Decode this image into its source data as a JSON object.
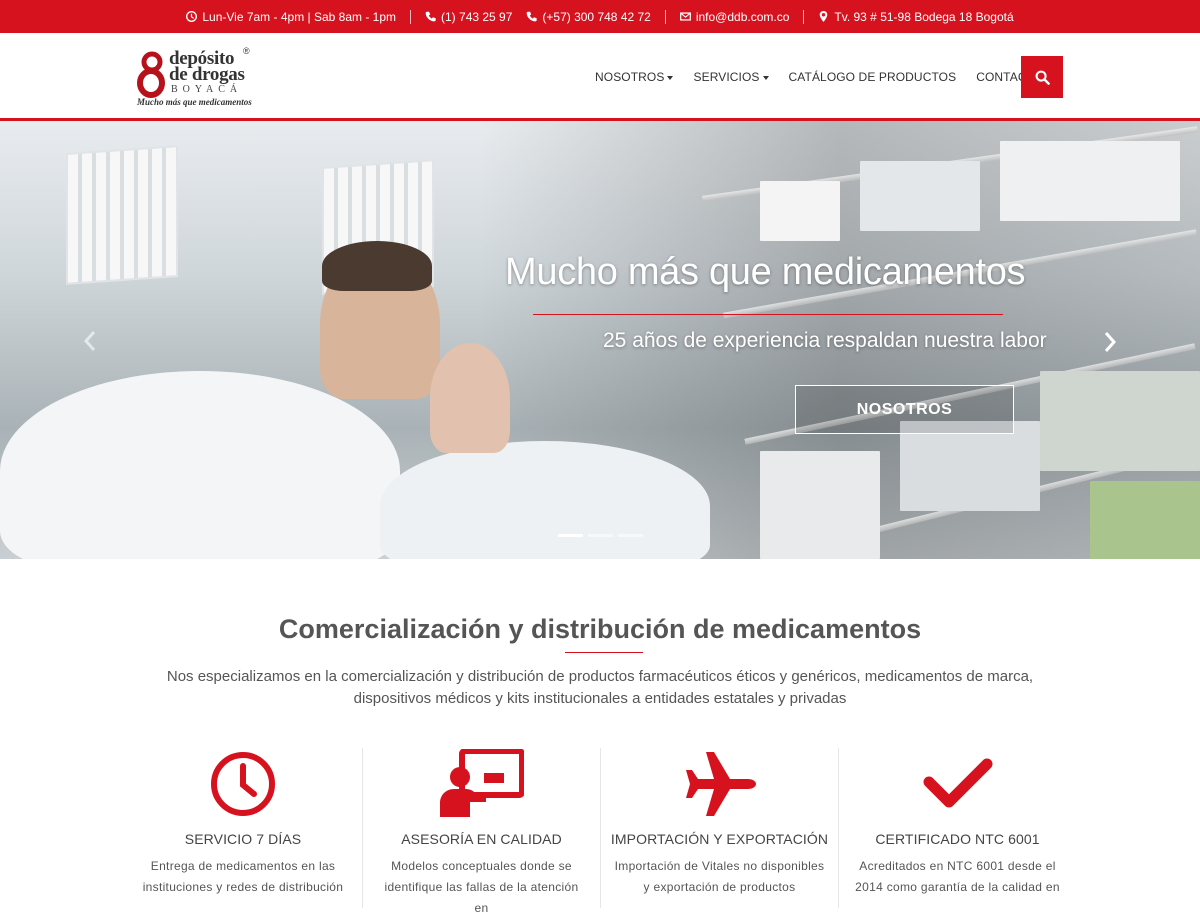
{
  "colors": {
    "brand": "#d7121f",
    "text": "#444444",
    "white": "#ffffff"
  },
  "topbar": {
    "hours": "Lun-Vie 7am - 4pm | Sab 8am - 1pm",
    "phone1": "(1) 743 25 97",
    "phone2": "(+57) 300 748 42 72",
    "email": "info@ddb.com.co",
    "address": "Tv. 93 # 51-98 Bodega 18 Bogotá",
    "icons": [
      "clock-icon",
      "phone-icon",
      "phone-icon",
      "envelope-icon",
      "map-marker-icon"
    ]
  },
  "logo": {
    "line1": "depósito",
    "line2": "de drogas",
    "line3": "BOYACÁ",
    "tagline": "Mucho más que medicamentos",
    "registered": "®"
  },
  "nav": {
    "items": [
      {
        "label": "NOSOTROS",
        "dropdown": true
      },
      {
        "label": "SERVICIOS",
        "dropdown": true
      },
      {
        "label": "CATÁLOGO DE PRODUCTOS",
        "dropdown": false
      },
      {
        "label": "CONTACTO",
        "dropdown": true
      }
    ],
    "search_icon": "search-icon"
  },
  "hero": {
    "title": "Mucho más que medicamentos",
    "subtitle": "25 años de experiencia respaldan nuestra labor",
    "button": "NOSOTROS",
    "slides": 3,
    "active_slide": 1
  },
  "intro": {
    "title": "Comercialización y distribución de medicamentos",
    "text": "Nos especializamos en la comercialización y distribución de productos farmacéuticos éticos y genéricos, medicamentos de marca, dispositivos médicos y kits institucionales a entidades estatales y privadas"
  },
  "features": [
    {
      "icon": "clock-icon",
      "title": "SERVICIO 7 DÍAS",
      "text": "Entrega de medicamentos en las instituciones y redes de distribución"
    },
    {
      "icon": "presentation-icon",
      "title": "ASESORÍA EN CALIDAD",
      "text": "Modelos conceptuales donde se identifique las fallas de la atención en"
    },
    {
      "icon": "plane-icon",
      "title": "IMPORTACIÓN Y EXPORTACIÓN",
      "text": "Importación de Vitales no disponibles y exportación de productos"
    },
    {
      "icon": "check-icon",
      "title": "CERTIFICADO NTC 6001",
      "text": "Acreditados en NTC 6001 desde el 2014 como garantía de la calidad en"
    }
  ]
}
